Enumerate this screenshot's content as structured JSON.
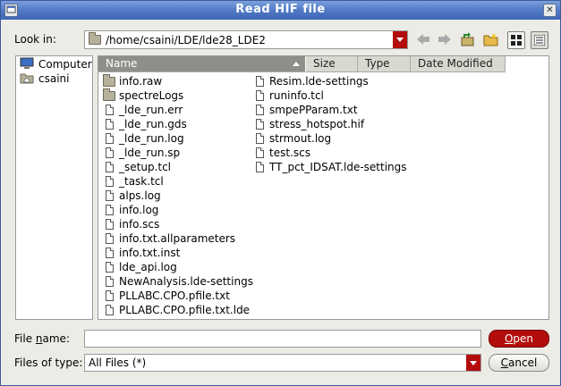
{
  "window": {
    "title": "Read HIF file",
    "menu_icon": "window-menu-icon",
    "close_icon": "close-icon"
  },
  "look_in": {
    "label": "Look in:",
    "value": "/home/csaini/LDE/lde28_LDE2",
    "icon": "folder-icon"
  },
  "toolbar": {
    "icons": [
      "back-arrow-icon",
      "forward-arrow-icon",
      "parent-folder-icon",
      "new-folder-icon",
      "list-view-icon",
      "detail-view-icon"
    ]
  },
  "sidebar": {
    "items": [
      {
        "label": "Computer",
        "icon": "computer-icon"
      },
      {
        "label": "csaini",
        "icon": "home-folder-icon"
      }
    ]
  },
  "columns": [
    {
      "label": "Name"
    },
    {
      "label": "Size"
    },
    {
      "label": "Type"
    },
    {
      "label": "Date Modified"
    }
  ],
  "files_col1": [
    {
      "name": "info.raw",
      "kind": "folder"
    },
    {
      "name": "spectreLogs",
      "kind": "folder"
    },
    {
      "name": "_lde_run.err",
      "kind": "file"
    },
    {
      "name": "_lde_run.gds",
      "kind": "file"
    },
    {
      "name": "_lde_run.log",
      "kind": "file"
    },
    {
      "name": "_lde_run.sp",
      "kind": "file"
    },
    {
      "name": "_setup.tcl",
      "kind": "file"
    },
    {
      "name": "_task.tcl",
      "kind": "file"
    },
    {
      "name": "alps.log",
      "kind": "file"
    },
    {
      "name": "info.log",
      "kind": "file"
    },
    {
      "name": "info.scs",
      "kind": "file"
    },
    {
      "name": "info.txt.allparameters",
      "kind": "file"
    },
    {
      "name": "info.txt.inst",
      "kind": "file"
    },
    {
      "name": "lde_api.log",
      "kind": "file"
    },
    {
      "name": "NewAnalysis.lde-settings",
      "kind": "file"
    },
    {
      "name": "PLLABC.CPO.pfile.txt",
      "kind": "file"
    },
    {
      "name": "PLLABC.CPO.pfile.txt.lde",
      "kind": "file"
    }
  ],
  "files_col2": [
    {
      "name": "Resim.lde-settings",
      "kind": "file"
    },
    {
      "name": "runinfo.tcl",
      "kind": "file"
    },
    {
      "name": "smpePParam.txt",
      "kind": "file"
    },
    {
      "name": "stress_hotspot.hif",
      "kind": "file"
    },
    {
      "name": "strmout.log",
      "kind": "file"
    },
    {
      "name": "test.scs",
      "kind": "file"
    },
    {
      "name": "TT_pct_IDSAT.lde-settings",
      "kind": "file"
    }
  ],
  "file_name": {
    "label_pre": "File ",
    "label_u": "n",
    "label_post": "ame:",
    "value": ""
  },
  "file_type": {
    "label": "Files of type:",
    "value": "All Files (*)"
  },
  "buttons": {
    "open_u": "O",
    "open_rest": "pen",
    "cancel_u": "C",
    "cancel_rest": "ancel"
  },
  "colors": {
    "accent": "#b20c0c",
    "titlebar": "#4f77c4"
  }
}
